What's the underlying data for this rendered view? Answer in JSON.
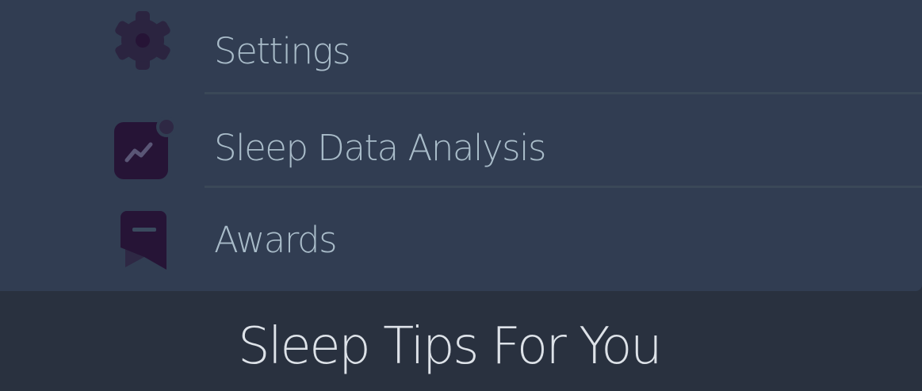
{
  "menu": {
    "items": [
      {
        "id": "settings",
        "label": "Settings",
        "icon": "gear-icon"
      },
      {
        "id": "sleep-data-analysis",
        "label": "Sleep Data Analysis",
        "icon": "chart-icon",
        "has_notification_dot": true
      },
      {
        "id": "awards",
        "label": "Awards",
        "icon": "bookmark-icon"
      }
    ]
  },
  "tips_section": {
    "title": "Sleep Tips For You"
  },
  "colors": {
    "page_background": "#29313f",
    "card_background": "#313d52",
    "label_text": "#a9bcc9",
    "icon_fill": "#261436",
    "title_text": "#dde2e8"
  }
}
